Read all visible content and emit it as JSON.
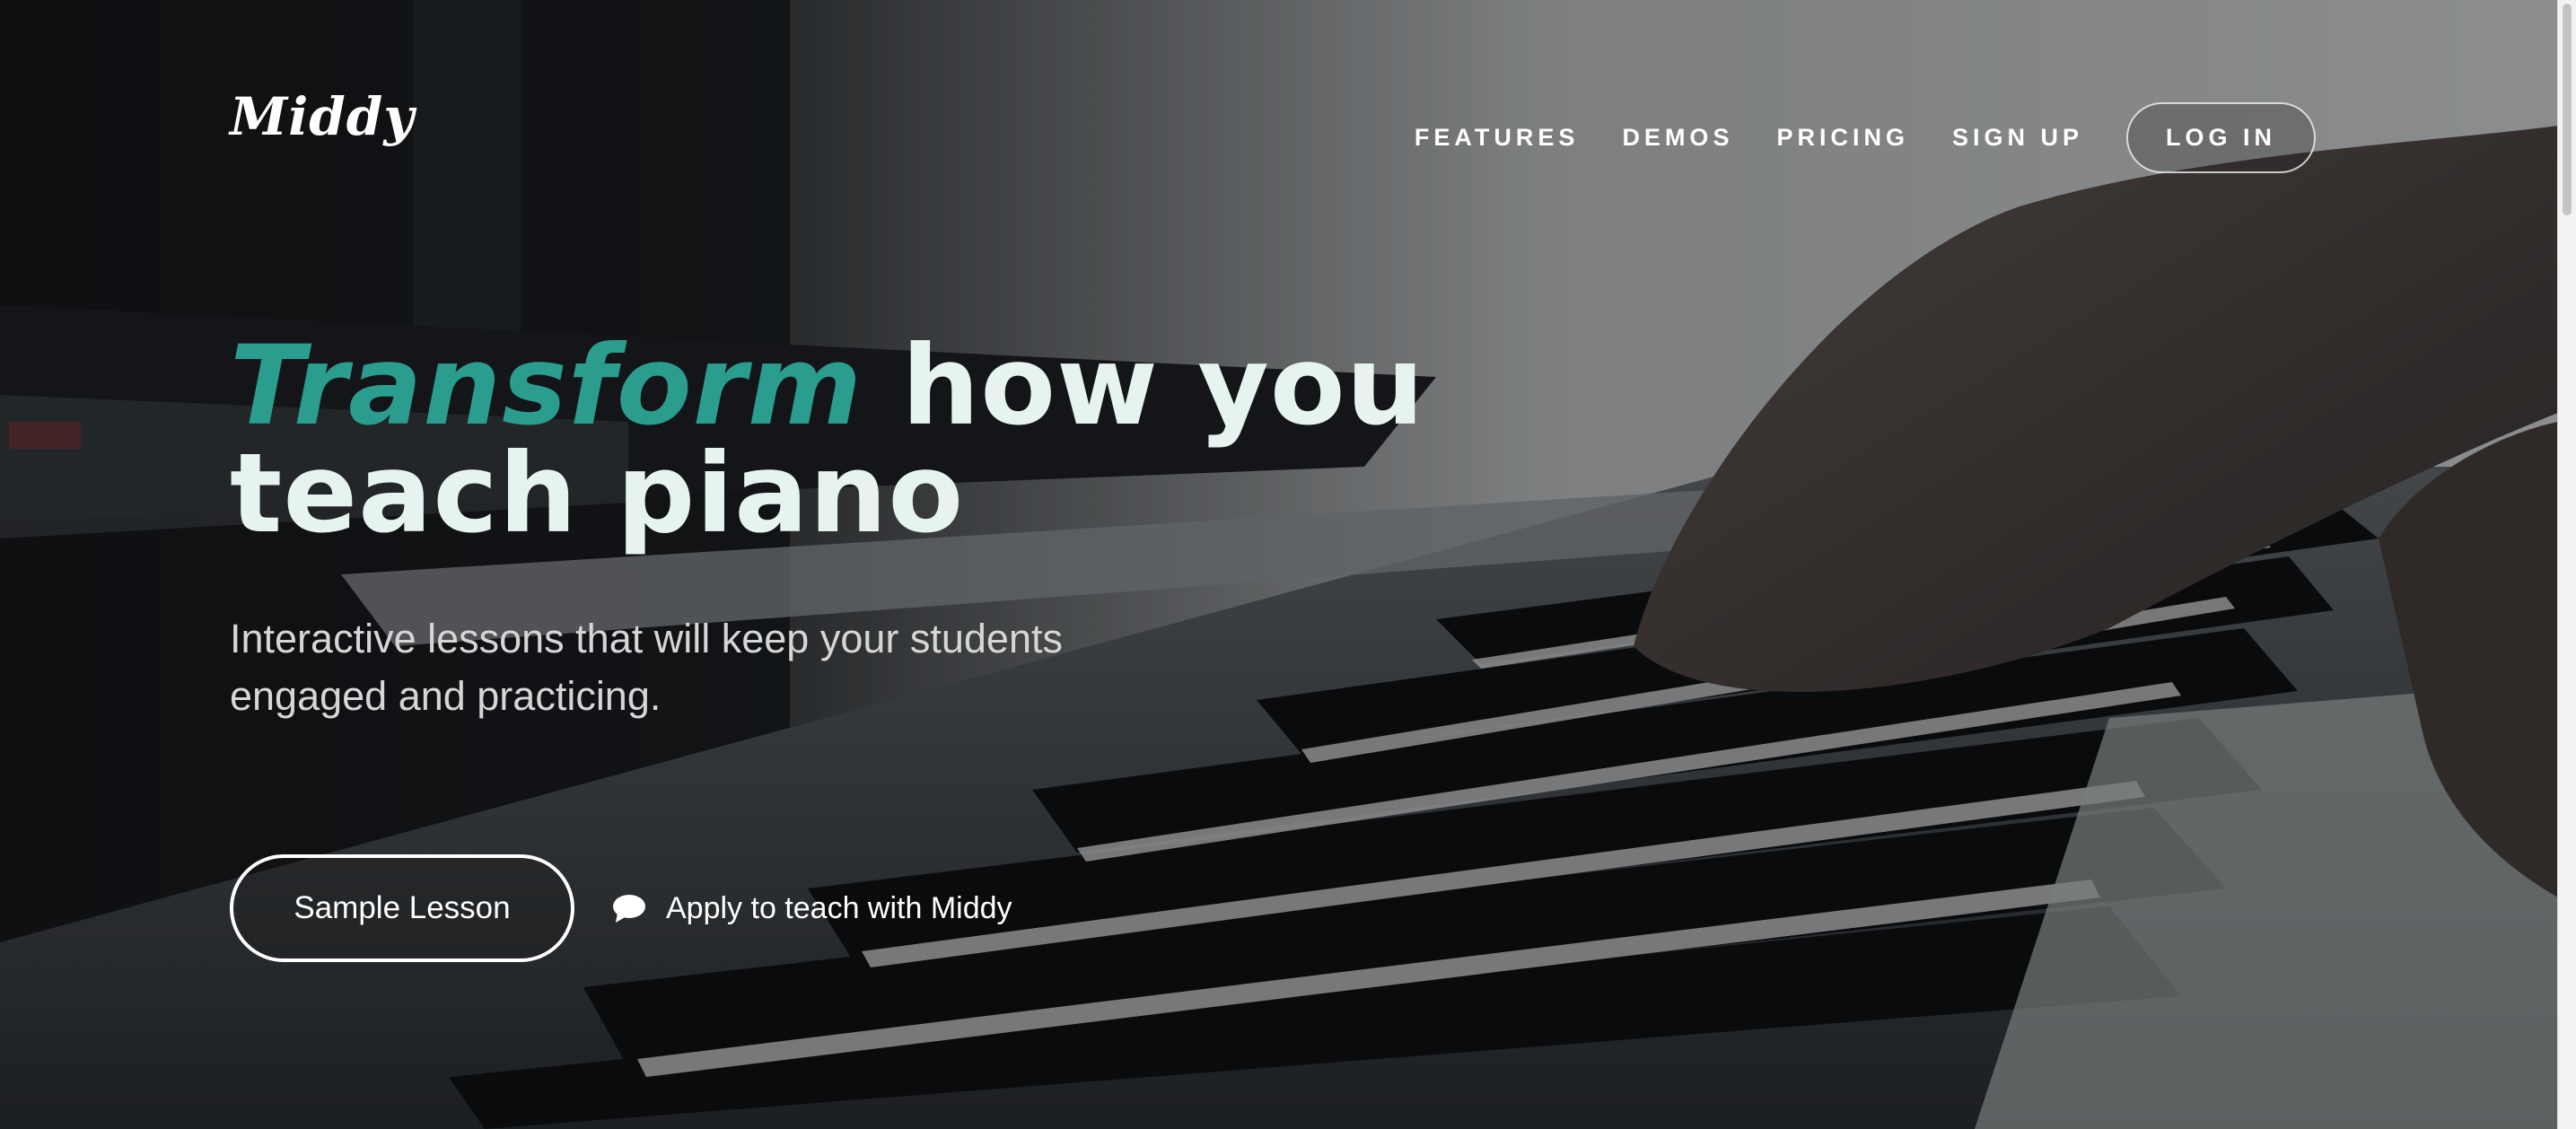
{
  "brand": {
    "logo": "Middy"
  },
  "nav": {
    "links": [
      "FEATURES",
      "DEMOS",
      "PRICING",
      "SIGN UP"
    ],
    "login": "LOG IN"
  },
  "hero": {
    "headline_accent": "Transform",
    "headline_rest": " how you",
    "headline_line2": "teach piano",
    "subtitle": "Interactive lessons that will keep your students engaged and practicing.",
    "primary_cta": "Sample Lesson",
    "secondary_cta": "Apply to teach with Middy",
    "secondary_icon": "chat-bubble-icon"
  },
  "colors": {
    "accent": "#2a9d8f",
    "headline": "#e6f3ef"
  }
}
